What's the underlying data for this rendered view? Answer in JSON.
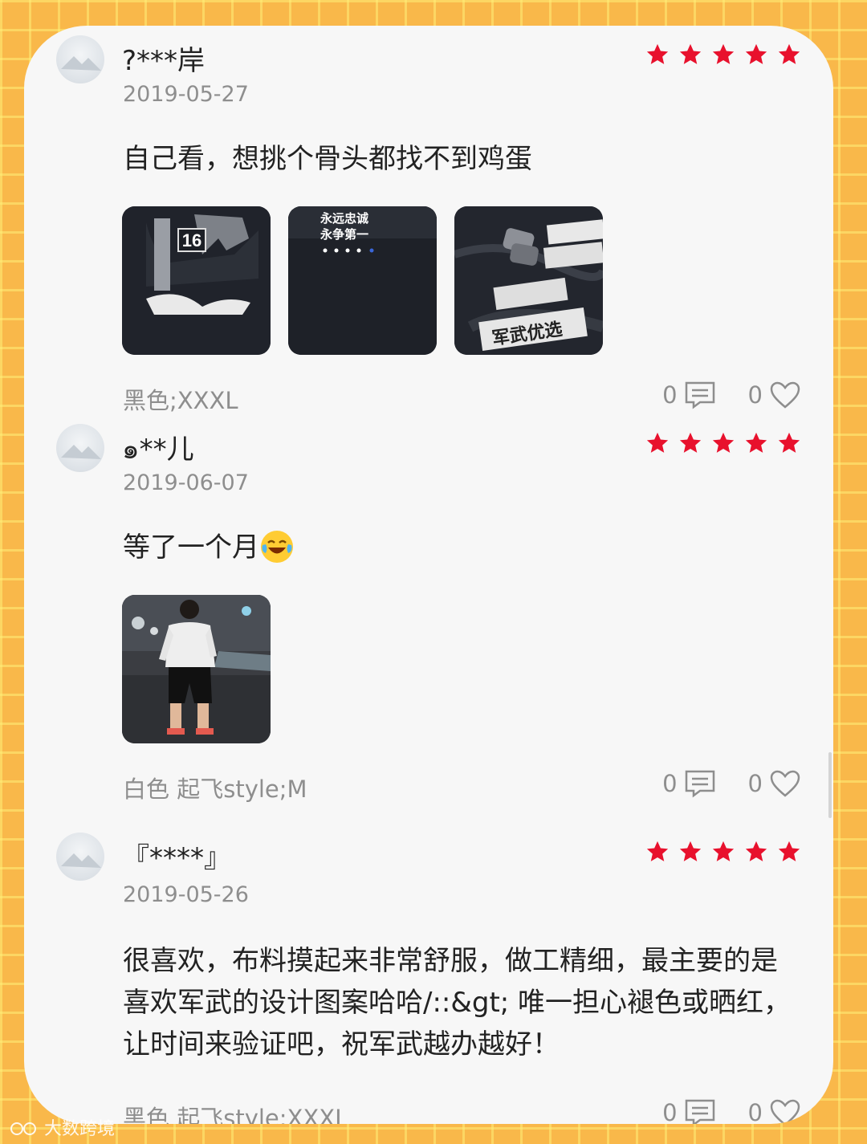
{
  "reviews": [
    {
      "username": "?***岸",
      "date": "2019-05-27",
      "rating": 5,
      "text": "自己看，想挑个骨头都找不到鸡蛋",
      "photos": [
        {
          "icon": "black-tshirt-front-photo",
          "text": "16"
        },
        {
          "icon": "black-tshirt-back-photo",
          "text": "永远忠诚 永争第一"
        },
        {
          "icon": "brand-tags-photo",
          "text": "军武优选"
        }
      ],
      "variant": "黑色;XXXL",
      "comments": "0",
      "likes": "0"
    },
    {
      "username": "๑**儿",
      "date": "2019-06-07",
      "rating": 5,
      "text": "等了一个月",
      "emoji": "laughing-crying-emoji",
      "photos": [
        {
          "icon": "man-in-white-tshirt-photo",
          "text": ""
        }
      ],
      "variant": "白色 起飞style;M",
      "comments": "0",
      "likes": "0"
    },
    {
      "username": "『****』",
      "date": "2019-05-26",
      "rating": 5,
      "text": "很喜欢，布料摸起来非常舒服，做工精细，最主要的是喜欢军武的设计图案哈哈/::&gt; 唯一担心褪色或晒红，让时间来验证吧，祝军武越办越好！",
      "photos": [],
      "variant": "黑色 起飞style;XXXL",
      "comments": "0",
      "likes": "0"
    }
  ],
  "colors": {
    "star": "#e8112d",
    "background": "#f9b84a",
    "card": "#f7f7f7"
  },
  "icons": {
    "comment": "comment-icon",
    "like": "heart-icon",
    "star": "star-icon"
  },
  "watermark": "大数跨境"
}
